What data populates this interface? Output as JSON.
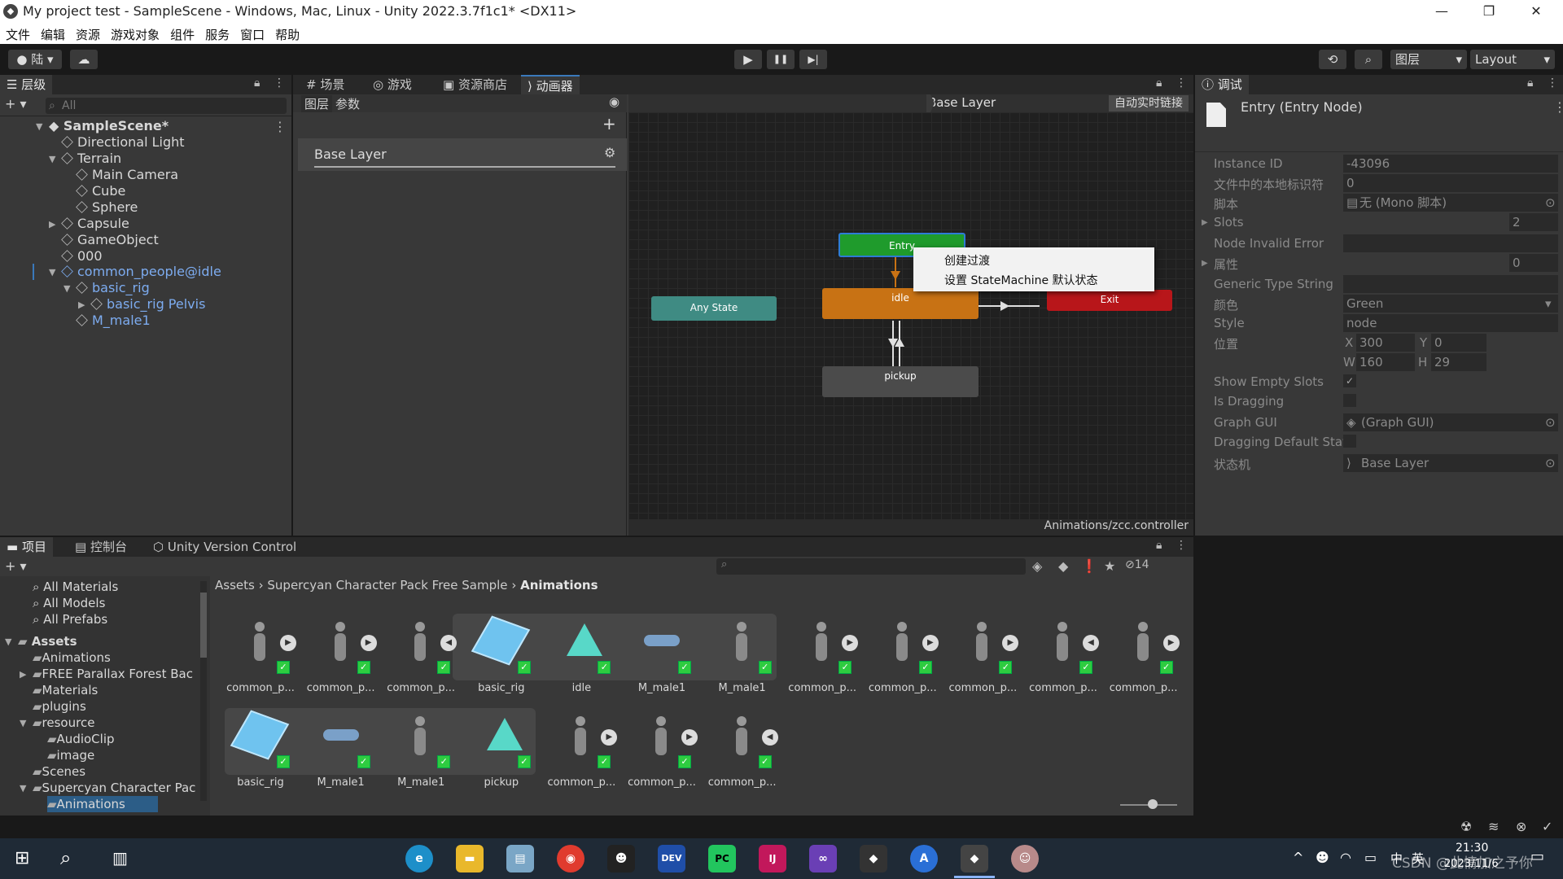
{
  "window": {
    "title": "My project test - SampleScene - Windows, Mac, Linux - Unity 2022.3.7f1c1* <DX11>",
    "controls": [
      "—",
      "❐",
      "✕"
    ]
  },
  "menu": [
    "文件",
    "编辑",
    "资源",
    "游戏对象",
    "组件",
    "服务",
    "窗口",
    "帮助"
  ],
  "toolbar": {
    "account": "陆",
    "play": "▶",
    "pause": "❚❚",
    "step": "▶|",
    "layers": "图层",
    "layout": "Layout"
  },
  "hierarchy": {
    "tab": "层级",
    "search_placeholder": "All",
    "scene": "SampleScene*",
    "items": [
      {
        "label": "Directional Light"
      },
      {
        "label": "Terrain"
      },
      {
        "label": "Main Camera"
      },
      {
        "label": "Cube"
      },
      {
        "label": "Sphere"
      },
      {
        "label": "Capsule"
      },
      {
        "label": "GameObject"
      },
      {
        "label": "000"
      },
      {
        "label": "common_people@idle"
      },
      {
        "label": "basic_rig"
      },
      {
        "label": "basic_rig Pelvis"
      },
      {
        "label": "M_male1"
      }
    ]
  },
  "center_tabs": [
    "场景",
    "游戏",
    "资源商店",
    "动画器"
  ],
  "animator": {
    "subtabs": [
      "图层",
      "参数"
    ],
    "breadcrumb": "Base Layer",
    "auto_live_link": "自动实时链接",
    "layer_name": "Base Layer",
    "footer_path": "Animations/zcc.controller",
    "nodes": {
      "entry": "Entry",
      "any_state": "Any State",
      "idle": "idle",
      "exit": "Exit",
      "pickup": "pickup"
    },
    "context_menu": [
      "创建过渡",
      "设置 StateMachine 默认状态"
    ]
  },
  "inspector": {
    "tab": "调试",
    "object_title": "Entry (Entry Node)",
    "props": {
      "instance_id_label": "Instance ID",
      "instance_id": "-43096",
      "local_id_label": "文件中的本地标识符",
      "local_id": "0",
      "script_label": "脚本",
      "script": "无 (Mono 脚本)",
      "slots_label": "Slots",
      "slots": "2",
      "node_invalid_label": "Node Invalid Error",
      "attrs_label": "属性",
      "attrs": "0",
      "generic_type_label": "Generic Type String",
      "color_label": "颜色",
      "color": "Green",
      "style_label": "Style",
      "style": "node",
      "position_label": "位置",
      "x_label": "X",
      "x": "300",
      "y_label": "Y",
      "y": "0",
      "w_label": "W",
      "w": "160",
      "h_label": "H",
      "h": "29",
      "show_empty_label": "Show Empty Slots",
      "is_dragging_label": "Is Dragging",
      "graph_gui_label": "Graph GUI",
      "graph_gui": "(Graph GUI)",
      "dragging_default_label": "Dragging Default Stat",
      "state_machine_label": "状态机",
      "state_machine": "Base Layer"
    }
  },
  "bottom_tabs": [
    "项目",
    "控制台",
    "Unity Version Control"
  ],
  "project": {
    "hidden_count": "14",
    "breadcrumb": [
      "Assets",
      "Supercyan Character Pack Free Sample",
      "Animations"
    ],
    "favorites": [
      "All Materials",
      "All Models",
      "All Prefabs"
    ],
    "tree": [
      {
        "label": "Assets"
      },
      {
        "label": "Animations"
      },
      {
        "label": "FREE Parallax Forest Bac"
      },
      {
        "label": "Materials"
      },
      {
        "label": "plugins"
      },
      {
        "label": "resource"
      },
      {
        "label": "AudioClip"
      },
      {
        "label": "image"
      },
      {
        "label": "Scenes"
      },
      {
        "label": "Supercyan Character Pac"
      },
      {
        "label": "Animations"
      }
    ],
    "assets_row1": [
      "common_p...",
      "common_p...",
      "common_p...",
      "basic_rig",
      "idle",
      "M_male1",
      "M_male1",
      "common_p...",
      "common_p...",
      "common_p...",
      "common_p...",
      "common_p..."
    ],
    "assets_row2": [
      "basic_rig",
      "M_male1",
      "M_male1",
      "pickup",
      "common_p...",
      "common_p...",
      "common_p..."
    ]
  },
  "taskbar": {
    "time": "21:30",
    "date": "2023/11/6",
    "ime": "英",
    "ime2": "中",
    "watermark": "CSDN @此情加之予你"
  },
  "colors": {
    "entry": "#1f9b2c",
    "any_state": "#3f8b83",
    "idle": "#c87214",
    "exit": "#b8161a",
    "pickup": "#4b4b4b",
    "accent": "#3a79bb"
  }
}
